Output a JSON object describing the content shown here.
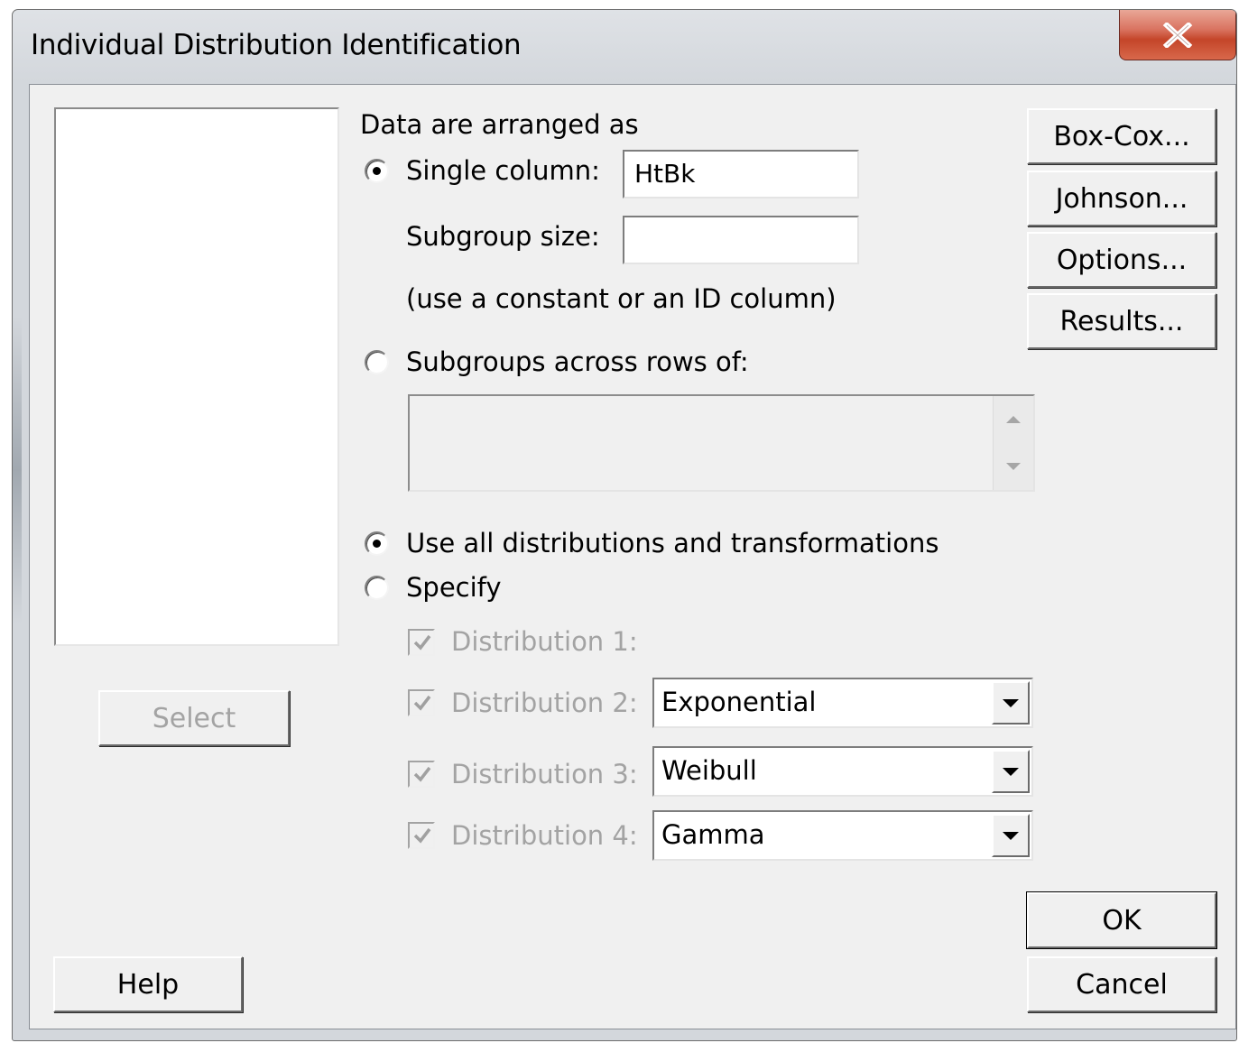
{
  "window": {
    "title": "Individual Distribution Identification",
    "close_icon": "close-icon"
  },
  "left_panel": {
    "select_label": "Select"
  },
  "data_arrangement": {
    "heading": "Data are arranged as",
    "single_column_label": "Single column:",
    "single_column_value": "HtBk",
    "subgroup_size_label": "Subgroup size:",
    "subgroup_size_value": "",
    "hint": "(use a constant or an ID column)",
    "subgroups_across_label": "Subgroups across rows of:",
    "selected": "single_column"
  },
  "distribution_choice": {
    "use_all_label": "Use all distributions and transformations",
    "specify_label": "Specify",
    "selected": "use_all"
  },
  "distributions": [
    {
      "label": "Distribution 1:",
      "checked": true,
      "value": null
    },
    {
      "label": "Distribution 2:",
      "checked": true,
      "value": "Exponential"
    },
    {
      "label": "Distribution 3:",
      "checked": true,
      "value": "Weibull"
    },
    {
      "label": "Distribution 4:",
      "checked": true,
      "value": "Gamma"
    }
  ],
  "side_buttons": {
    "box_cox": "Box-Cox...",
    "johnson": "Johnson...",
    "options": "Options...",
    "results": "Results..."
  },
  "footer": {
    "help": "Help",
    "ok": "OK",
    "cancel": "Cancel"
  }
}
